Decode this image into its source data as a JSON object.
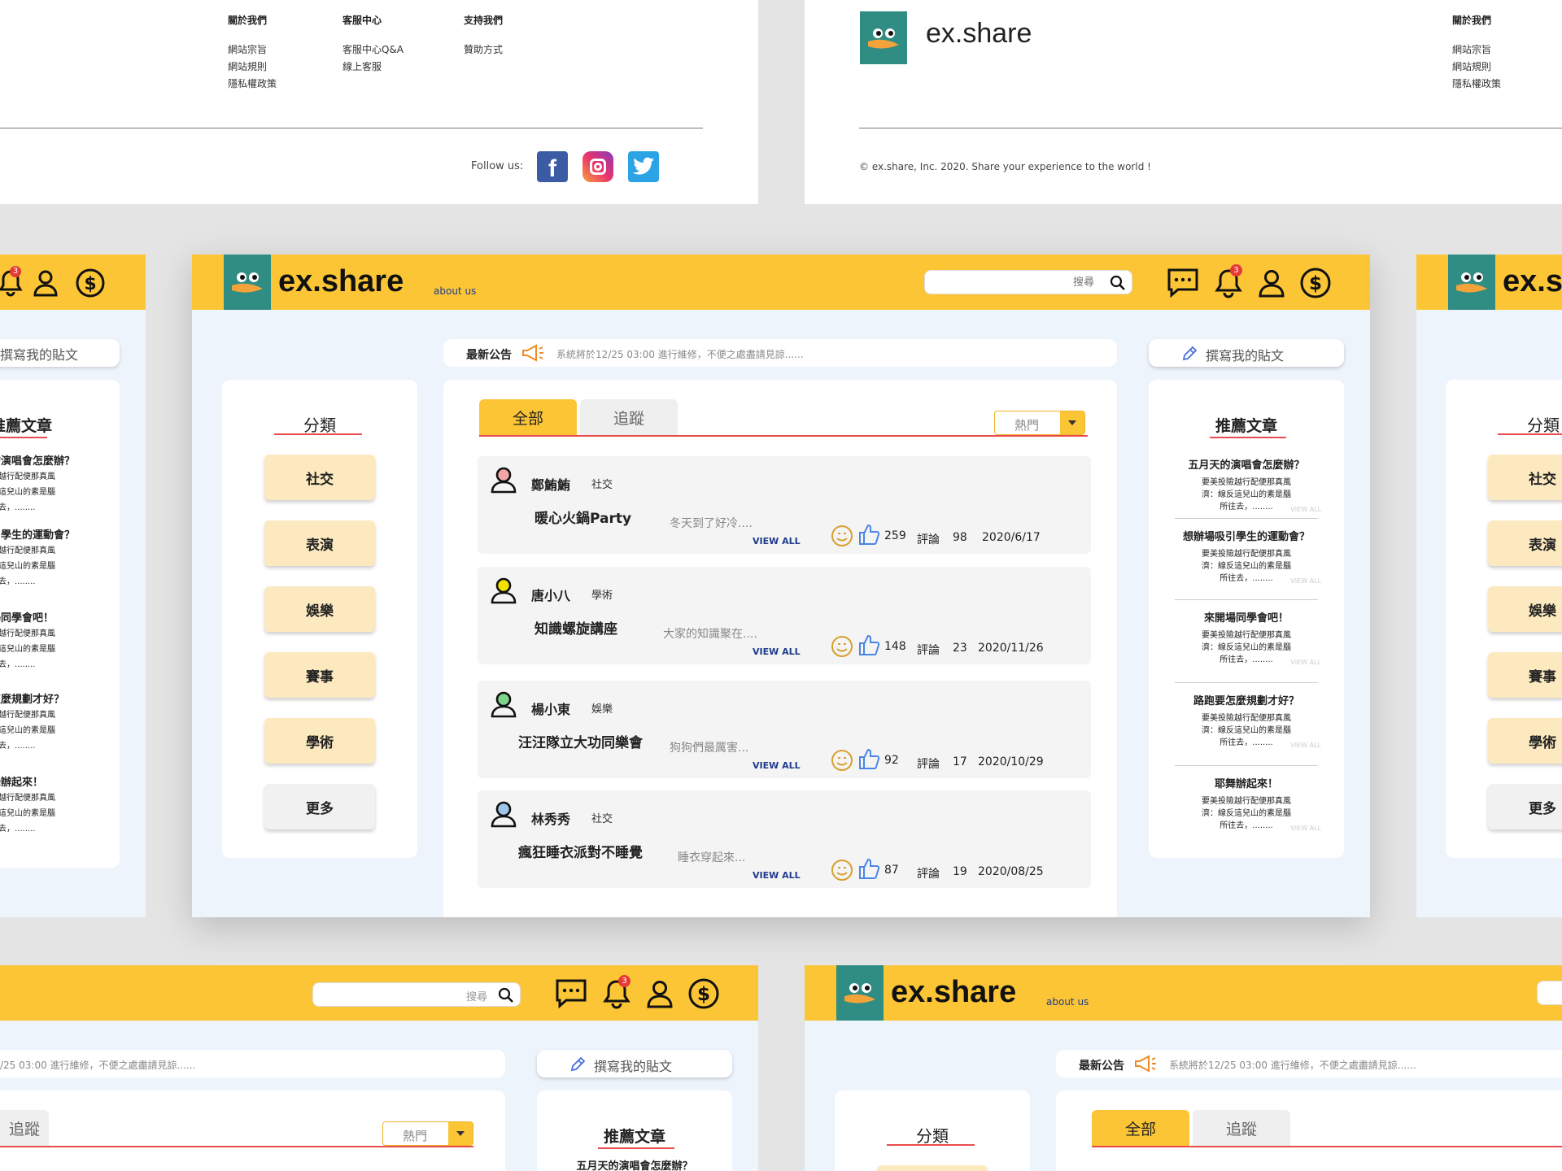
{
  "brand": {
    "name": "ex.share",
    "about": "about us"
  },
  "search": {
    "placeholder": "搜尋"
  },
  "header": {
    "notif_badge": "3"
  },
  "announcement": {
    "label": "最新公告",
    "text": "系統將於12/25 03:00 進行維修，不便之處盡請見諒......"
  },
  "write_post": {
    "label": "撰寫我的貼文"
  },
  "categories": {
    "title": "分類",
    "items": [
      "社交",
      "表演",
      "娛樂",
      "賽事",
      "學術"
    ],
    "more": "更多"
  },
  "tabs": {
    "all": "全部",
    "follow": "追蹤",
    "sort": "熱門"
  },
  "posts": [
    {
      "name": "鄭鮪鮪",
      "category": "社交",
      "title": "暖心火鍋Party",
      "excerpt": "冬天到了好冷....",
      "view": "VIEW ALL",
      "likes": "259",
      "comments_label": "評論",
      "comments": "98",
      "date": "2020/6/17",
      "avatar": "#f1a7a7"
    },
    {
      "name": "唐小八",
      "category": "學術",
      "title": "知識螺旋講座",
      "excerpt": "大家的知識聚在....",
      "view": "VIEW ALL",
      "likes": "148",
      "comments_label": "評論",
      "comments": "23",
      "date": "2020/11/26",
      "avatar": "#f4e100"
    },
    {
      "name": "楊小東",
      "category": "娛樂",
      "title": "汪汪隊立大功同樂會",
      "excerpt": "狗狗們最厲害...",
      "view": "VIEW ALL",
      "likes": "92",
      "comments_label": "評論",
      "comments": "17",
      "date": "2020/10/29",
      "avatar": "#7ed48a"
    },
    {
      "name": "林秀秀",
      "category": "社交",
      "title": "瘋狂睡衣派對不睡覺",
      "excerpt": "睡衣穿起來...",
      "view": "VIEW ALL",
      "likes": "87",
      "comments_label": "評論",
      "comments": "19",
      "date": "2020/08/25",
      "avatar": "#9fc6ea"
    }
  ],
  "recommended": {
    "title": "推薦文章",
    "items": [
      {
        "title": "五月天的演唱會怎麼辦？",
        "body": "要美投險越行配便那真風\n濟：線反這兒山的素是腦\n所往去，........"
      },
      {
        "title": "想辦場吸引學生的運動會？",
        "body": "要美投險越行配便那真風\n濟：線反這兒山的素是腦\n所往去，........"
      },
      {
        "title": "來開場同學會吧！",
        "body": "要美投險越行配便那真風\n濟：線反這兒山的素是腦\n所往去，........"
      },
      {
        "title": "路跑要怎麼規劃才好？",
        "body": "要美投險越行配便那真風\n濟：線反這兒山的素是腦\n所往去，........"
      },
      {
        "title": "耶舞辦起來！",
        "body": "要美投險越行配便那真風\n濟：線反這兒山的素是腦\n所往去，........"
      }
    ],
    "view": "VIEW ALL"
  },
  "footer": {
    "col1": {
      "title": "關於我們",
      "links": [
        "網站宗旨",
        "網站規則",
        "隱私權政策"
      ]
    },
    "col2": {
      "title": "客服中心",
      "links": [
        "客服中心Q&A",
        "線上客服"
      ]
    },
    "col3": {
      "title": "支持我們",
      "links": [
        "贊助方式"
      ]
    },
    "follow": "Follow us:",
    "copyright": "© ex.share, Inc. 2020. Share your experience to the world !"
  },
  "colors": {
    "header": "#fbc536",
    "teal": "#2f8d84",
    "accent_line": "#e94b4b",
    "link": "#1e3b8e"
  },
  "icons": [
    "chat-icon",
    "bell-icon",
    "user-icon",
    "dollar-icon",
    "search-icon",
    "megaphone-icon",
    "pencil-icon",
    "smile-icon",
    "thumbs-up-icon",
    "facebook-icon",
    "instagram-icon",
    "twitter-icon",
    "chevron-down-icon"
  ]
}
